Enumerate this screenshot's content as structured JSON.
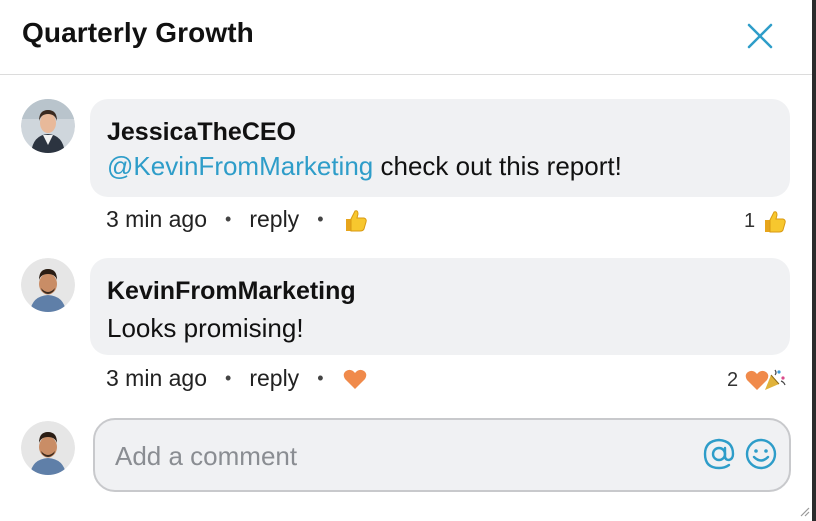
{
  "header": {
    "title": "Quarterly Growth"
  },
  "comments": [
    {
      "author": "JessicaTheCEO",
      "mention": "@KevinFromMarketing",
      "body": "check out this report!",
      "time": "3 min ago",
      "reply_label": "reply",
      "reaction_count": "1",
      "reaction_icons": [
        "thumbs-up-icon"
      ]
    },
    {
      "author": "KevinFromMarketing",
      "mention": "",
      "body": "Looks promising!",
      "time": "3 min ago",
      "reply_label": "reply",
      "reaction_count": "2",
      "reaction_icons": [
        "heart-icon",
        "party-popper-icon"
      ]
    }
  ],
  "composer": {
    "placeholder": "Add a comment"
  },
  "meta": {
    "separator": "•"
  },
  "colors": {
    "accent": "#2e9dc9",
    "bubble": "#f0f1f3",
    "thumb": "#f7c72e",
    "heart": "#f08a4b"
  }
}
